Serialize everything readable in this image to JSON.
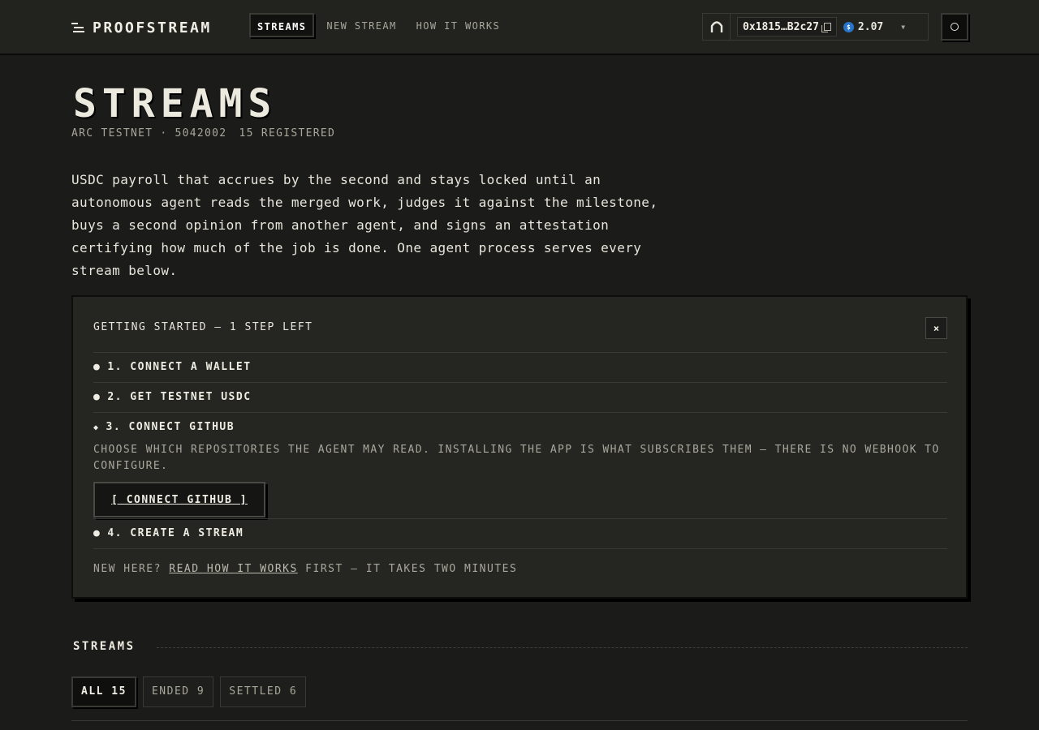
{
  "brand": {
    "name": "PROOFSTREAM"
  },
  "nav": [
    {
      "label": "STREAMS",
      "active": true
    },
    {
      "label": "NEW STREAM"
    },
    {
      "label": "HOW IT WORKS"
    }
  ],
  "wallet": {
    "address": "0x1815…B2c27",
    "balance": "2.07",
    "token_icon": "usdc-icon"
  },
  "header": {
    "title": "STREAMS",
    "network": "ARC TESTNET",
    "chain_id": "5042002",
    "registered": "15 REGISTERED",
    "separator": "·"
  },
  "intro": "USDC payroll that accrues by the second and stays locked until an autonomous agent reads the merged work, judges it against the milestone, buys a second opinion from another agent, and signs an attestation certifying how much of the job is done. One agent process serves every stream below.",
  "getting_started": {
    "title": "GETTING STARTED — 1 STEP LEFT",
    "close": "×",
    "steps": [
      {
        "bullet": "●",
        "label": "1. CONNECT A WALLET"
      },
      {
        "bullet": "●",
        "label": "2. GET TESTNET USDC"
      },
      {
        "bullet": "◆",
        "label": "3. CONNECT GITHUB"
      },
      {
        "bullet": "●",
        "label": "4. CREATE A STREAM"
      }
    ],
    "step3_desc": "CHOOSE WHICH REPOSITORIES THE AGENT MAY READ. INSTALLING THE APP IS WHAT SUBSCRIBES THEM — THERE IS NO WEBHOOK TO CONFIGURE.",
    "connect_button": "[ CONNECT GITHUB ]",
    "footer_prefix": "NEW HERE?",
    "footer_link": "READ HOW IT WORKS",
    "footer_suffix": "FIRST — IT TAKES TWO MINUTES"
  },
  "streams_section": {
    "title": "STREAMS",
    "filters": [
      {
        "label": "ALL 15",
        "active": true
      },
      {
        "label": "ENDED 9"
      },
      {
        "label": "SETTLED 6"
      }
    ]
  }
}
